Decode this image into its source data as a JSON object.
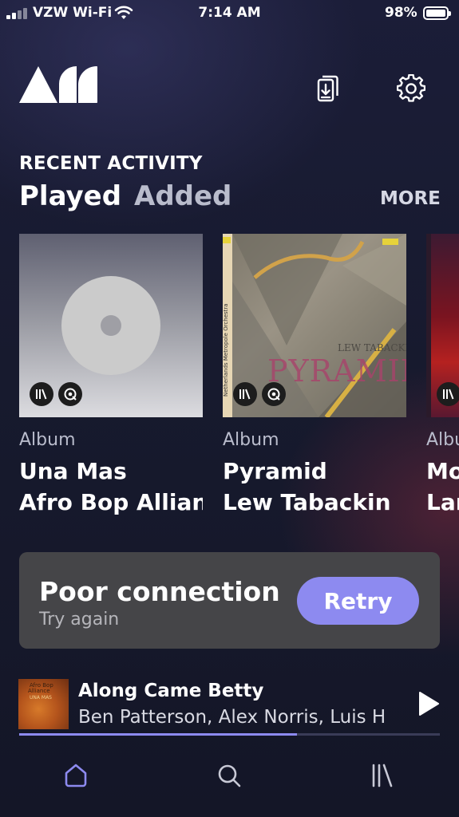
{
  "status_bar": {
    "carrier": "VZW Wi-Fi",
    "time": "7:14 AM",
    "battery": "98%",
    "battery_level": 0.98
  },
  "header": {
    "logo_icon": "arc-logo",
    "actions": [
      {
        "icon": "downloads-icon"
      },
      {
        "icon": "gear-icon"
      }
    ]
  },
  "recent": {
    "section_title": "RECENT ACTIVITY",
    "tabs": [
      {
        "label": "Played",
        "active": true
      },
      {
        "label": "Added",
        "active": false
      }
    ],
    "more_label": "MORE",
    "cards": [
      {
        "type": "Album",
        "title": "Una Mas",
        "artist": "Afro Bop Alliance",
        "art": "placeholder-disc"
      },
      {
        "type": "Album",
        "title": "Pyramid",
        "artist": "Lew Tabackin",
        "art": "pyramid-cover",
        "cover_text": {
          "artist": "LEW TABACKIN",
          "title": "PYRAMID",
          "orchestra": "Netherlands Metropole Orchestra"
        }
      },
      {
        "type": "Albu",
        "title": "Mo",
        "artist": "Lar",
        "art": "red-cover"
      }
    ]
  },
  "connection": {
    "title": "Poor connection",
    "subtitle": "Try again",
    "retry_label": "Retry"
  },
  "now_playing": {
    "title": "Along Came Betty",
    "artist": "Ben Patterson, Alex Norris, Luis He",
    "art_text": {
      "line1": "Afro Bop",
      "line2": "Alliance",
      "line3": "UNA MAS"
    },
    "progress": 0.66
  },
  "nav": [
    {
      "icon": "home-icon",
      "active": true
    },
    {
      "icon": "search-icon",
      "active": false
    },
    {
      "icon": "library-icon",
      "active": false
    }
  ],
  "colors": {
    "accent": "#8d8af0",
    "background": "#171a2e",
    "banner": "#454548"
  }
}
